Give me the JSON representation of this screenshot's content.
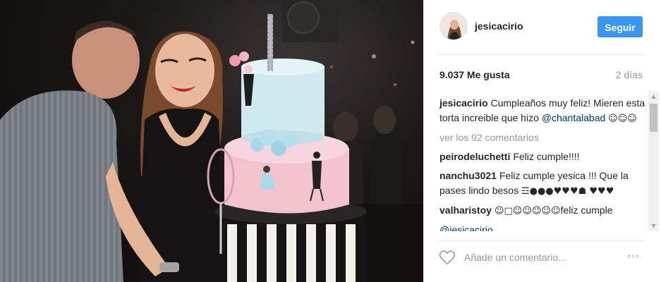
{
  "post": {
    "username": "jesicacirio",
    "follow_label": "Seguir",
    "likes": "9.037 Me gusta",
    "time_ago": "2 días",
    "comment_placeholder": "Añade un comentario...",
    "more_label": "◦◦◦"
  },
  "caption": {
    "user": "jesicacirio",
    "text": "Cumpleaños muy feliz! Mieren esta torta increible que hizo ",
    "mention": "@chantalabad",
    "emoji": "☺☺☺"
  },
  "view_all": "ver los 92 comentarios",
  "comments": [
    {
      "user": "peirodeluchetti",
      "text": "Feliz cumple!!!!",
      "emoji": ""
    },
    {
      "user": "nanchu3021",
      "text": "Feliz cumple yesica !!! Que la pases lindo besos ",
      "emoji": "☲●●●♥♥♥☗ ♥♥♥"
    },
    {
      "user": "valharistoy",
      "text": "feliz cumple",
      "emoji": "☺□☺☺☺☺☺"
    },
    {
      "user": "",
      "text": "@jesicacirio",
      "emoji": ""
    }
  ],
  "colors": {
    "accent": "#3897f0",
    "text": "#262626",
    "muted": "#999999",
    "mention": "#003569"
  },
  "icons": {
    "like": "heart-icon",
    "more": "ellipsis-icon"
  }
}
